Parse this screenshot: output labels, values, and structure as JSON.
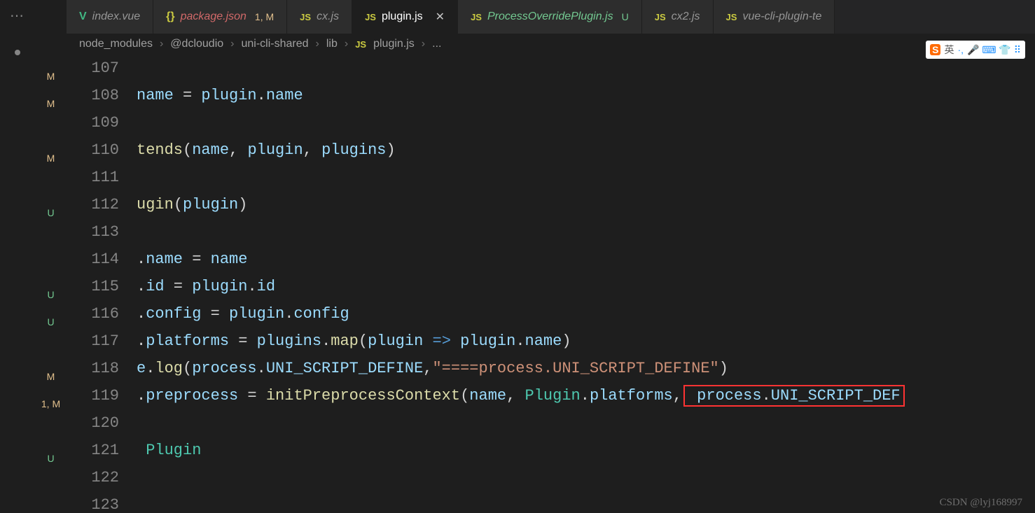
{
  "tabs": [
    {
      "icon": "V",
      "iconClass": "icon-vue",
      "label": "index.vue",
      "status": "",
      "active": false
    },
    {
      "icon": "{}",
      "iconClass": "icon-json",
      "label": "package.json",
      "status": "1, M",
      "active": false,
      "pjson": true
    },
    {
      "icon": "JS",
      "iconClass": "icon-js",
      "label": "cx.js",
      "status": "",
      "active": false
    },
    {
      "icon": "JS",
      "iconClass": "icon-js",
      "label": "plugin.js",
      "status": "",
      "active": true,
      "close": true
    },
    {
      "icon": "JS",
      "iconClass": "icon-js",
      "label": "ProcessOverridePlugin.js",
      "status": "U",
      "active": false,
      "git": true
    },
    {
      "icon": "JS",
      "iconClass": "icon-js",
      "label": "cx2.js",
      "status": "",
      "active": false
    },
    {
      "icon": "JS",
      "iconClass": "icon-js",
      "label": "vue-cli-plugin-te",
      "status": "",
      "active": false
    }
  ],
  "breadcrumb": {
    "parts": [
      "node_modules",
      "@dcloudio",
      "uni-cli-shared",
      "lib"
    ],
    "fileIcon": "JS",
    "file": "plugin.js",
    "extra": "..."
  },
  "scm_badges": [
    "M",
    "M",
    "",
    "M",
    "",
    "U",
    "",
    "",
    "U",
    "U",
    "",
    "M",
    "1, M",
    "",
    "U"
  ],
  "line_numbers": [
    "107",
    "108",
    "109",
    "110",
    "111",
    "112",
    "113",
    "114",
    "115",
    "116",
    "117",
    "118",
    "119",
    "120",
    "121",
    "122",
    "123"
  ],
  "code_lines": {
    "l108": {
      "pre": "",
      "t": [
        [
          "tok-var",
          "name"
        ],
        [
          "tok-plain",
          " = "
        ],
        [
          "tok-var",
          "plugin"
        ],
        [
          "tok-plain",
          "."
        ],
        [
          "tok-prop",
          "name"
        ]
      ]
    },
    "l110": {
      "pre": "",
      "t": [
        [
          "tok-fn",
          "tends"
        ],
        [
          "tok-plain",
          "("
        ],
        [
          "tok-var",
          "name"
        ],
        [
          "tok-plain",
          ", "
        ],
        [
          "tok-var",
          "plugin"
        ],
        [
          "tok-plain",
          ", "
        ],
        [
          "tok-var",
          "plugins"
        ],
        [
          "tok-plain",
          ")"
        ]
      ]
    },
    "l112": {
      "pre": "",
      "t": [
        [
          "tok-fn",
          "ugin"
        ],
        [
          "tok-plain",
          "("
        ],
        [
          "tok-var",
          "plugin"
        ],
        [
          "tok-plain",
          ")"
        ]
      ]
    },
    "l114": {
      "pre": "",
      "t": [
        [
          "tok-plain",
          "."
        ],
        [
          "tok-prop",
          "name"
        ],
        [
          "tok-plain",
          " = "
        ],
        [
          "tok-var",
          "name"
        ]
      ]
    },
    "l115": {
      "pre": "",
      "t": [
        [
          "tok-plain",
          "."
        ],
        [
          "tok-prop",
          "id"
        ],
        [
          "tok-plain",
          " = "
        ],
        [
          "tok-var",
          "plugin"
        ],
        [
          "tok-plain",
          "."
        ],
        [
          "tok-prop",
          "id"
        ]
      ]
    },
    "l116": {
      "pre": "",
      "t": [
        [
          "tok-plain",
          "."
        ],
        [
          "tok-prop",
          "config"
        ],
        [
          "tok-plain",
          " = "
        ],
        [
          "tok-var",
          "plugin"
        ],
        [
          "tok-plain",
          "."
        ],
        [
          "tok-prop",
          "config"
        ]
      ]
    },
    "l117": {
      "pre": "",
      "t": [
        [
          "tok-plain",
          "."
        ],
        [
          "tok-prop",
          "platforms"
        ],
        [
          "tok-plain",
          " = "
        ],
        [
          "tok-var",
          "plugins"
        ],
        [
          "tok-plain",
          "."
        ],
        [
          "tok-fn",
          "map"
        ],
        [
          "tok-plain",
          "("
        ],
        [
          "tok-var",
          "plugin"
        ],
        [
          "tok-plain",
          " "
        ],
        [
          "tok-kw",
          "=>"
        ],
        [
          "tok-plain",
          " "
        ],
        [
          "tok-var",
          "plugin"
        ],
        [
          "tok-plain",
          "."
        ],
        [
          "tok-prop",
          "name"
        ],
        [
          "tok-plain",
          ")"
        ]
      ]
    },
    "l118": {
      "pre": "",
      "t": [
        [
          "tok-var",
          "e"
        ],
        [
          "tok-plain",
          "."
        ],
        [
          "tok-fn",
          "log"
        ],
        [
          "tok-plain",
          "("
        ],
        [
          "tok-var",
          "process"
        ],
        [
          "tok-plain",
          "."
        ],
        [
          "tok-prop",
          "UNI_SCRIPT_DEFINE"
        ],
        [
          "tok-plain",
          ","
        ],
        [
          "tok-str",
          "\"====process.UNI_SCRIPT_DEFINE\""
        ],
        [
          "tok-plain",
          ")"
        ]
      ]
    },
    "l119": {
      "pre": "",
      "t": [
        [
          "tok-plain",
          "."
        ],
        [
          "tok-prop",
          "preprocess"
        ],
        [
          "tok-plain",
          " = "
        ],
        [
          "tok-fn",
          "initPreprocessContext"
        ],
        [
          "tok-plain",
          "("
        ],
        [
          "tok-var",
          "name"
        ],
        [
          "tok-plain",
          ", "
        ],
        [
          "tok-cls",
          "Plugin"
        ],
        [
          "tok-plain",
          "."
        ],
        [
          "tok-prop",
          "platforms"
        ],
        [
          "tok-plain",
          ","
        ]
      ],
      "box": [
        [
          "tok-plain",
          " "
        ],
        [
          "tok-var",
          "process"
        ],
        [
          "tok-plain",
          "."
        ],
        [
          "tok-prop",
          "UNI_SCRIPT_DEF"
        ]
      ]
    },
    "l121": {
      "pre": " ",
      "t": [
        [
          "tok-cls",
          "Plugin"
        ]
      ]
    }
  },
  "watermark": "CSDN @lyj168997",
  "ime": {
    "brand": "S",
    "lang": "英",
    "sep": "·,",
    "icons": "🎤 ⌨ 👕 ⠿"
  },
  "activity": "⋯"
}
